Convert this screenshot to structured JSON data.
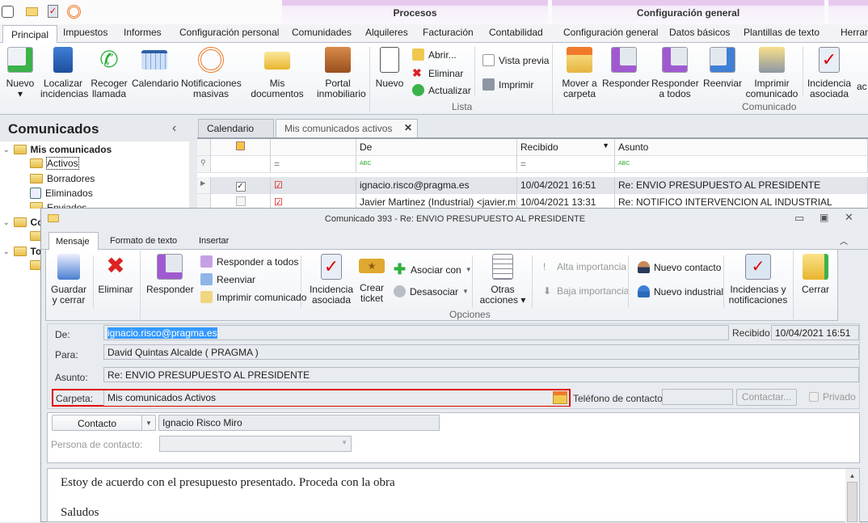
{
  "quick_access": {
    "icons": [
      "app-menu-icon",
      "mail-icon",
      "task-icon",
      "broadcast-icon"
    ]
  },
  "context_groups": {
    "procesos": "Procesos",
    "config": "Configuración general"
  },
  "main_tabs": [
    "Principal",
    "Impuestos",
    "Informes",
    "Configuración personal",
    "Comunidades",
    "Alquileres",
    "Facturación",
    "Contabilidad",
    "Configuración general",
    "Datos básicos",
    "Plantillas de texto",
    "Herram"
  ],
  "ribbon": {
    "big": [
      "Nuevo",
      "Localizar incidencias",
      "Recoger llamada",
      "Calendario",
      "Notificaciones masivas",
      "Mis documentos",
      "Portal inmobiliario",
      "Nuevo"
    ],
    "lista": {
      "abrir": "Abrir...",
      "eliminar": "Eliminar",
      "actualizar": "Actualizar",
      "vista_previa": "Vista previa",
      "imprimir": "Imprimir",
      "label": "Lista"
    },
    "comunicado": [
      "Mover a carpeta",
      "Responder",
      "Responder a todos",
      "Reenviar",
      "Imprimir comunicado"
    ],
    "comunicado_label": "Comunicado",
    "incidencia": "Incidencia asociada",
    "cut": "ac"
  },
  "left_panel": {
    "title": "Comunicados",
    "collapse": "‹",
    "tree": {
      "root": "Mis comunicados",
      "items": [
        "Activos",
        "Borradores",
        "Eliminados",
        "Enviados"
      ],
      "other1": "Co",
      "other2": "To"
    }
  },
  "doc_tabs": {
    "calendar": "Calendario",
    "active": "Mis comunicados activos",
    "close": "✕"
  },
  "grid": {
    "headers": {
      "de": "De",
      "recibido": "Recibido",
      "asunto": "Asunto"
    },
    "filter": {
      "eq": "=",
      "abc": "ABC"
    },
    "rows": [
      {
        "checked": true,
        "de": "ignacio.risco@pragma.es",
        "recibido": "10/04/2021 16:51",
        "asunto": "Re: ENVIO PRESUPUESTO AL PRESIDENTE"
      },
      {
        "checked": false,
        "de": "Javier Martinez (Industrial) <javier.m...",
        "recibido": "10/04/2021 13:31",
        "asunto": "Re: NOTIFICO INTERVENCION AL INDUSTRIAL"
      }
    ]
  },
  "dialog": {
    "title": "Comunicado 393 - Re: ENVIO PRESUPUESTO AL PRESIDENTE",
    "tabs": [
      "Mensaje",
      "Formato de texto",
      "Insertar"
    ],
    "ribbon": {
      "guardar": "Guardar y cerrar",
      "eliminar": "Eliminar",
      "responder": "Responder",
      "responder_todos": "Responder a todos",
      "reenviar": "Reenviar",
      "imprimir": "Imprimir comunicado",
      "incidencia": "Incidencia asociada",
      "ticket": "Crear ticket",
      "asociar": "Asociar con",
      "desasociar": "Desasociar",
      "otras": "Otras acciones",
      "alta": "Alta importancia",
      "baja": "Baja importancia",
      "nuevo_contacto": "Nuevo contacto",
      "nuevo_industrial": "Nuevo industrial",
      "incidencias_notif": "Incidencias y notificaciones",
      "cerrar": "Cerrar",
      "group": "Opciones"
    },
    "form": {
      "de_label": "De:",
      "de": "ignacio.risco@pragma.es",
      "recibido_label": "Recibido:",
      "recibido": "10/04/2021 16:51",
      "para_label": "Para:",
      "para": "David Quintas Alcalde ( PRAGMA )",
      "asunto_label": "Asunto:",
      "asunto": "Re: ENVIO PRESUPUESTO AL PRESIDENTE",
      "carpeta_label": "Carpeta:",
      "carpeta": "Mis comunicados  Activos",
      "telefono_label": "Teléfono de contacto:",
      "telefono": "",
      "contactar": "Contactar...",
      "privado": "Privado",
      "contacto_type": "Contacto",
      "contacto": "Ignacio Risco Miro",
      "persona_label": "Persona de contacto:",
      "persona": ""
    },
    "body": [
      "Estoy de acuerdo con el presupuesto presentado. Proceda con la obra",
      "Saludos"
    ]
  },
  "colors": {
    "highlight": "#e00000",
    "selection": "#3399ff",
    "context_purple": "#e7c9f0"
  }
}
